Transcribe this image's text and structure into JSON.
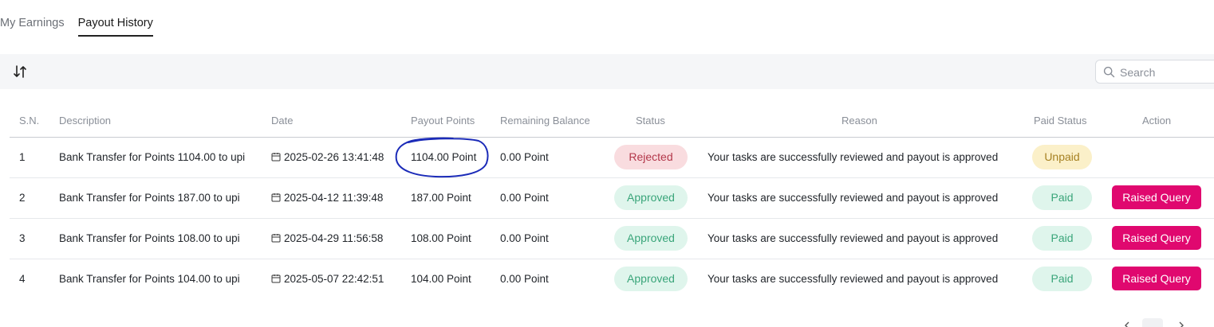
{
  "tabs": [
    {
      "label": "My Earnings",
      "active": false
    },
    {
      "label": "Payout History",
      "active": true
    }
  ],
  "toolbar": {
    "sort_icon": "sort-arrows-icon",
    "search": {
      "placeholder": "Search",
      "value": "",
      "icon": "search-icon"
    }
  },
  "table": {
    "headers": {
      "sn": "S.N.",
      "description": "Description",
      "date": "Date",
      "payout_points": "Payout Points",
      "remaining_balance": "Remaining Balance",
      "status": "Status",
      "reason": "Reason",
      "paid_status": "Paid Status",
      "action": "Action"
    },
    "rows": [
      {
        "sn": "1",
        "description": "Bank Transfer for Points 1104.00 to upi",
        "date": "2025-02-26 13:41:48",
        "payout_points": "1104.00 Point",
        "remaining_balance": "0.00 Point",
        "status": "Rejected",
        "reason": "Your tasks are successfully reviewed and payout is approved",
        "paid_status": "Unpaid",
        "action": ""
      },
      {
        "sn": "2",
        "description": "Bank Transfer for Points 187.00 to upi",
        "date": "2025-04-12 11:39:48",
        "payout_points": "187.00 Point",
        "remaining_balance": "0.00 Point",
        "status": "Approved",
        "reason": "Your tasks are successfully reviewed and payout is approved",
        "paid_status": "Paid",
        "action": "Raised Query"
      },
      {
        "sn": "3",
        "description": "Bank Transfer for Points 108.00 to upi",
        "date": "2025-04-29 11:56:58",
        "payout_points": "108.00 Point",
        "remaining_balance": "0.00 Point",
        "status": "Approved",
        "reason": "Your tasks are successfully reviewed and payout is approved",
        "paid_status": "Paid",
        "action": "Raised Query"
      },
      {
        "sn": "4",
        "description": "Bank Transfer for Points 104.00 to upi",
        "date": "2025-05-07 22:42:51",
        "payout_points": "104.00 Point",
        "remaining_balance": "0.00 Point",
        "status": "Approved",
        "reason": "Your tasks are successfully reviewed and payout is approved",
        "paid_status": "Paid",
        "action": "Raised Query"
      }
    ]
  },
  "colors": {
    "accent_button": "#e0086f",
    "annotation_circle": "#1b2bb8"
  }
}
